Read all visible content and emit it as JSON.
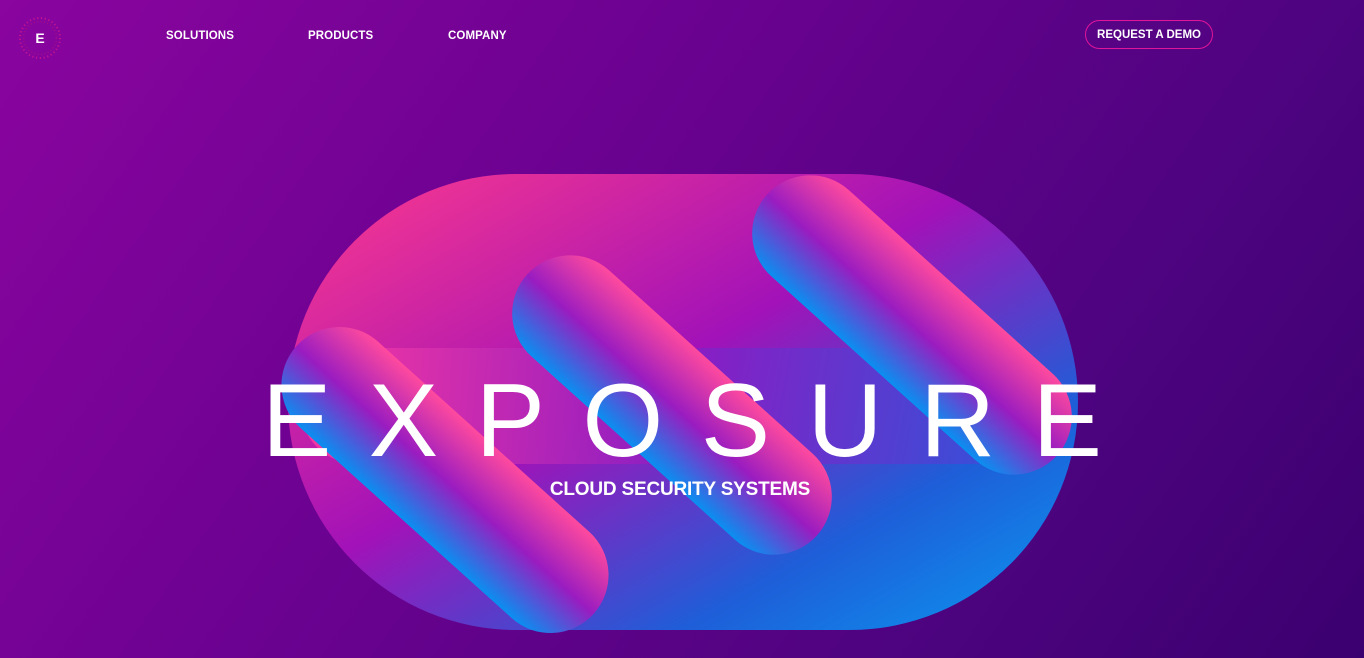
{
  "logo": {
    "letter": "E",
    "icon": "dotted-ring-logo-icon"
  },
  "nav": {
    "items": [
      {
        "label": "SOLUTIONS"
      },
      {
        "label": "PRODUCTS"
      },
      {
        "label": "COMPANY"
      }
    ]
  },
  "cta": {
    "label": "REQUEST A DEMO"
  },
  "hero": {
    "title": "EXPOSURE",
    "subtitle": "CLOUD SECURITY SYSTEMS",
    "graphic": "gradient-capsule-tubes-illustration"
  },
  "colors": {
    "background_start": "#8a049f",
    "background_end": "#3b006f",
    "accent_pink": "#ff3a8c",
    "accent_blue": "#0a8ff0",
    "cta_border": "#e0159a"
  }
}
